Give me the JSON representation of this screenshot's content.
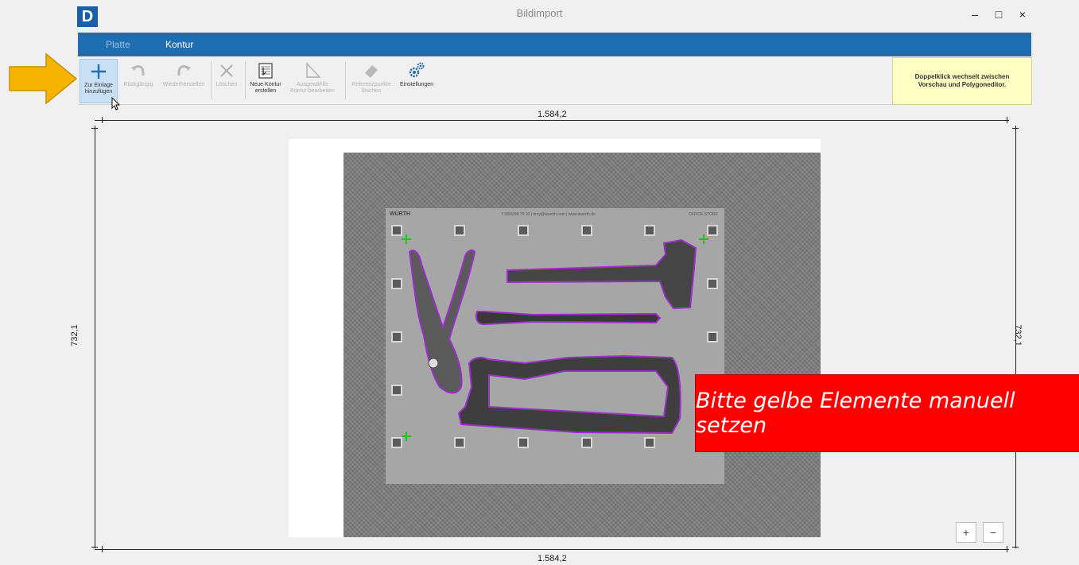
{
  "window": {
    "logo_letter": "D",
    "title": "Bildimport",
    "minimize": "–",
    "maximize": "□",
    "close": "×"
  },
  "ribbon": {
    "tabs": [
      {
        "label": "Platte",
        "active": false
      },
      {
        "label": "Kontur",
        "active": true
      }
    ]
  },
  "toolbar": {
    "buttons": [
      {
        "label_1": "Zur Einlage",
        "label_2": "hinzufügen",
        "icon": "plus-icon",
        "enabled": true
      },
      {
        "label_1": "Rückgängig",
        "label_2": "",
        "icon": "undo-icon",
        "enabled": false
      },
      {
        "label_1": "Wiederherstellen",
        "label_2": "",
        "icon": "redo-icon",
        "enabled": false
      },
      {
        "label_1": "Löschen",
        "label_2": "",
        "icon": "delete-icon",
        "enabled": false
      },
      {
        "label_1": "Neue Kontur",
        "label_2": "erstellen",
        "icon": "new-contour-icon",
        "enabled": true
      },
      {
        "label_1": "Ausgewählte",
        "label_2": "Kontur bearbeiten",
        "icon": "edit-contour-icon",
        "enabled": false
      },
      {
        "label_1": "Referenzpunkte",
        "label_2": "löschen",
        "icon": "eraser-icon",
        "enabled": false
      },
      {
        "label_1": "Einstellungen",
        "label_2": "",
        "icon": "gears-icon",
        "enabled": true
      }
    ]
  },
  "hint": {
    "line1": "Doppelklick wechselt zwischen",
    "line2": "Vorschau und Polygoneditor."
  },
  "dimensions": {
    "top": "1.584,2",
    "bottom": "1.584,2",
    "left": "732,1",
    "right": "732,1"
  },
  "board": {
    "brand": "WÜRTH",
    "phone": "T 0800/98 79 10 | orsy@wuerth.com | www.wuerth.de",
    "right": "OFFICE STORE"
  },
  "banner": {
    "text": "Bitte gelbe Elemente manuell setzen"
  },
  "zoom": {
    "in": "+",
    "out": "−"
  },
  "colors": {
    "accent": "#1f6db3",
    "arrow": "#f5b400",
    "banner": "#ff0000",
    "contour": "#9b30c8",
    "reference_point": "#22c022"
  }
}
